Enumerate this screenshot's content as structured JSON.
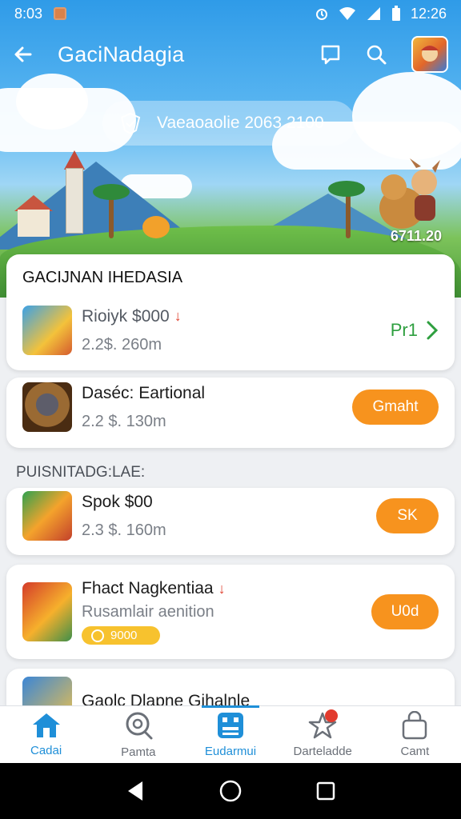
{
  "status_bar": {
    "time_left": "8:03",
    "time_right": "12:26"
  },
  "app_bar": {
    "title": "GaciNadagia"
  },
  "hero": {
    "search_text": "Vaeaoaolie  2063 2100",
    "tag": "6711.20"
  },
  "sections": {
    "first_header": "GACIJNAN IHEDASIA",
    "second_header": "PUISNITADG:LAE:"
  },
  "items": [
    {
      "name": "Rioiyk $000",
      "sub": "2.2$. 260m",
      "action": "Pr1"
    },
    {
      "name": "Daséc: Eartional",
      "sub": "2.2 $. 130m",
      "action": "Gmaht"
    },
    {
      "name": "Spok $00",
      "sub": "2.3 $. 160m",
      "action": "SK"
    },
    {
      "name": "Fhact Nagkentiaa",
      "sub": "Rusamlair aenition",
      "badge": "9000",
      "action": "U0d"
    },
    {
      "name": "Gaolc Dlapne Gihalnle"
    }
  ],
  "bottom_nav": [
    {
      "label": "Cadai"
    },
    {
      "label": "Pamta"
    },
    {
      "label": "Eudarmui"
    },
    {
      "label": "Darteladde"
    },
    {
      "label": "Camt"
    }
  ],
  "colors": {
    "accent_orange": "#f7931e",
    "accent_blue": "#1f8fd8",
    "accent_green": "#2e9f3f"
  },
  "icons": [
    "back-arrow-icon",
    "chat-icon",
    "search-icon",
    "home-icon",
    "search-nav-icon",
    "grid-icon",
    "star-icon",
    "bag-icon"
  ]
}
